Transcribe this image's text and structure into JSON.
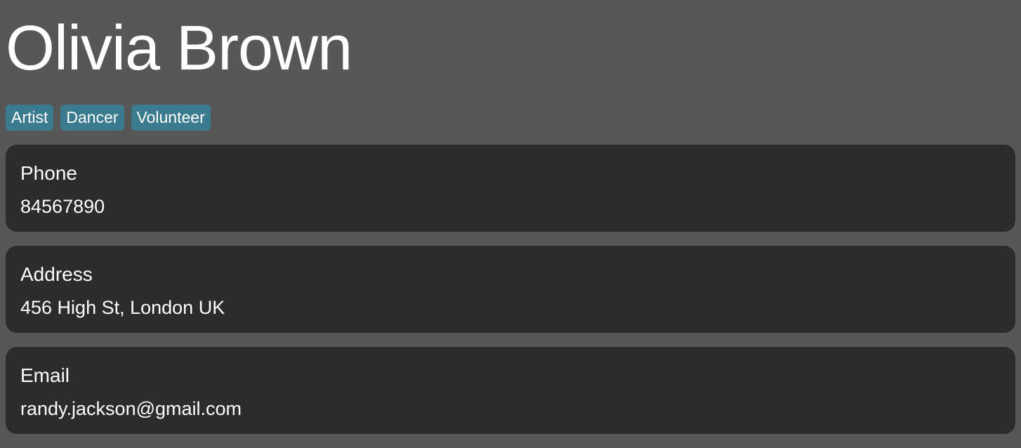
{
  "contact": {
    "name": "Olivia Brown",
    "tags": [
      "Artist",
      "Dancer",
      "Volunteer"
    ],
    "fields": {
      "phone": {
        "label": "Phone",
        "value": "84567890"
      },
      "address": {
        "label": "Address",
        "value": "456 High St, London UK"
      },
      "email": {
        "label": "Email",
        "value": "randy.jackson@gmail.com"
      }
    }
  },
  "colors": {
    "background": "#575757",
    "card": "#2c2c2c",
    "tag": "#3a7b8f",
    "text": "#ffffff"
  }
}
